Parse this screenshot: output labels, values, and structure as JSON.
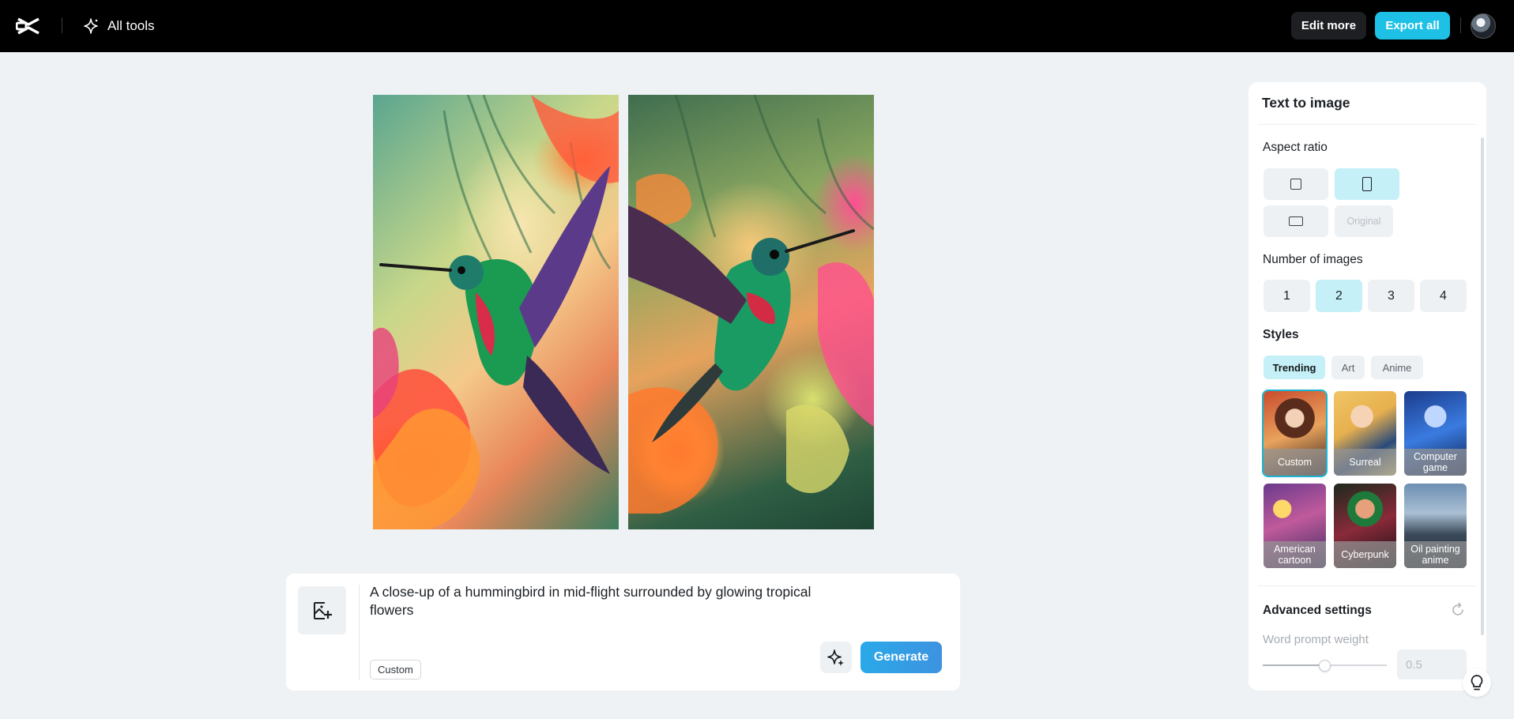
{
  "header": {
    "all_tools_label": "All tools",
    "edit_more_label": "Edit more",
    "export_all_label": "Export all"
  },
  "prompt": {
    "text": "A close-up of a hummingbird in mid-flight surrounded by glowing tropical flowers",
    "style_chip": "Custom",
    "generate_label": "Generate"
  },
  "panel": {
    "title": "Text to image",
    "aspect_ratio_label": "Aspect ratio",
    "aspect_ratio_original": "Original",
    "aspect_ratio_selected": "portrait",
    "number_label": "Number of images",
    "numbers": [
      "1",
      "2",
      "3",
      "4"
    ],
    "number_selected": "2",
    "styles_label": "Styles",
    "style_tabs": [
      "Trending",
      "Art",
      "Anime"
    ],
    "style_tab_selected": "Trending",
    "styles": [
      "Custom",
      "Surreal",
      "Computer game",
      "American cartoon",
      "Cyberpunk",
      "Oil painting anime"
    ],
    "style_selected": "Custom",
    "advanced_label": "Advanced settings",
    "word_prompt_weight_label": "Word prompt weight",
    "word_prompt_weight_value": "0.5"
  },
  "colors": {
    "accent": "#1ec0e6",
    "selected_bg": "#c6f0f7"
  }
}
